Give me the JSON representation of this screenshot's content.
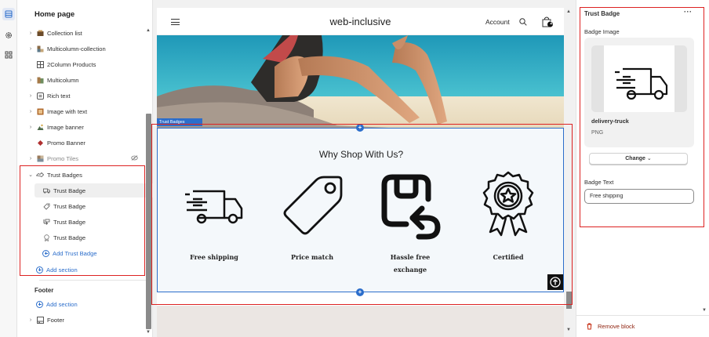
{
  "sidebar": {
    "title": "Home page",
    "sections": [
      {
        "label": "Collection list",
        "icon": "collection-icon"
      },
      {
        "label": "Multicolumn-collection",
        "icon": "multicolumn-icon"
      },
      {
        "label": "2Column Products",
        "icon": "grid-icon"
      },
      {
        "label": "Multicolumn",
        "icon": "multicolumn-icon"
      },
      {
        "label": "Rich text",
        "icon": "text-icon"
      },
      {
        "label": "Image with text",
        "icon": "image-text-icon"
      },
      {
        "label": "Image banner",
        "icon": "image-icon"
      },
      {
        "label": "Promo Banner",
        "icon": "promo-icon"
      },
      {
        "label": "Promo Tiles",
        "icon": "tiles-icon"
      }
    ],
    "trust_section": {
      "label": "Trust Badges",
      "blocks": [
        "Trust Badge",
        "Trust Badge",
        "Trust Badge",
        "Trust Badge"
      ],
      "add_block": "Add Trust Badge"
    },
    "add_section": "Add section",
    "footer_group": {
      "title": "Footer",
      "add_section": "Add section",
      "footer_item": "Footer"
    }
  },
  "preview": {
    "store_title": "web-inclusive",
    "account_label": "Account",
    "cart_count": "2",
    "section_tag": "Trust Badges",
    "trust_heading": "Why Shop With Us?",
    "badges": [
      {
        "label": "Free shipping",
        "icon": "delivery-truck-icon"
      },
      {
        "label": "Price match",
        "icon": "price-tag-icon"
      },
      {
        "label": "Hassle free exchange",
        "icon": "return-exchange-icon"
      },
      {
        "label": "Certified",
        "icon": "certified-badge-icon"
      }
    ]
  },
  "right_panel": {
    "title": "Trust Badge",
    "menu": "···",
    "image_label": "Badge Image",
    "image_name": "delivery-truck",
    "image_type": "PNG",
    "change_label": "Change",
    "text_label": "Badge Text",
    "text_value": "Free shipping",
    "remove_label": "Remove block"
  },
  "colors": {
    "accent": "#2c6ecb",
    "annotation": "#dd2222",
    "remove": "#8e1f0b"
  }
}
